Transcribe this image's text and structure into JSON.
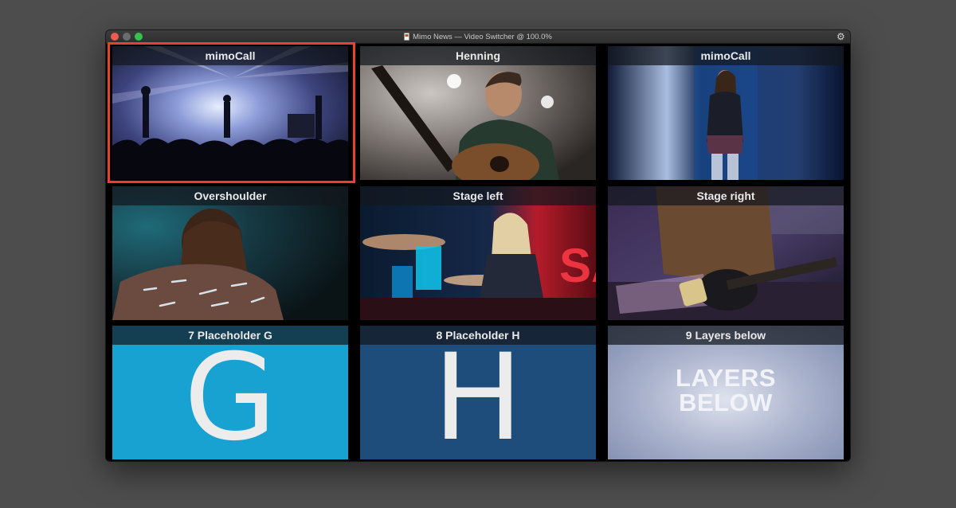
{
  "window": {
    "title": "Mimo News — Video Switcher @ 100.0%",
    "icons": {
      "document": "document-icon",
      "settings": "gear-icon"
    }
  },
  "tiles": [
    {
      "label": "mimoCall",
      "selected": true
    },
    {
      "label": "Henning",
      "selected": false
    },
    {
      "label": "mimoCall",
      "selected": false
    },
    {
      "label": "Overshoulder",
      "selected": false
    },
    {
      "label": "Stage left",
      "selected": false
    },
    {
      "label": "Stage right",
      "selected": false
    },
    {
      "label": "7 Placeholder G",
      "letter": "G",
      "color": "#18a2d2",
      "selected": false
    },
    {
      "label": "8 Placeholder H",
      "letter": "H",
      "color": "#1e4d7c",
      "selected": false
    },
    {
      "label": "9 Layers below",
      "line1": "LAYERS",
      "line2": "BELOW",
      "selected": false
    }
  ],
  "colors": {
    "selection": "#e8422c",
    "desktop": "#4d4d4d"
  }
}
